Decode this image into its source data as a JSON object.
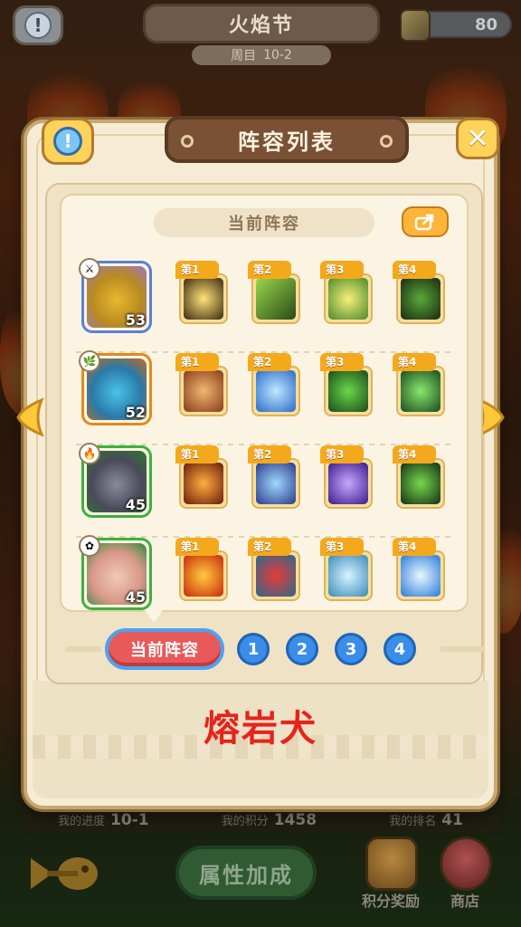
{
  "topbar": {
    "title": "火焰节",
    "subtitle_label": "周目",
    "subtitle_value": "10-2",
    "currency_value": "80"
  },
  "bottombar": {
    "stats": [
      {
        "label": "我的进度",
        "value": "10-1"
      },
      {
        "label": "我的积分",
        "value": "1458"
      },
      {
        "label": "我的排名",
        "value": "41"
      }
    ],
    "attr_button": "属性加成",
    "points_reward": "积分奖励",
    "shop": "商店"
  },
  "modal": {
    "title": "阵容列表",
    "info_glyph": "!",
    "close_glyph": "✕",
    "current_lineup_label": "当前阵容",
    "footer_name": "熔岩犬",
    "rows": [
      {
        "hero_level": "53",
        "hero_frame": "blue",
        "skills": [
          {
            "tag": "第1"
          },
          {
            "tag": "第2"
          },
          {
            "tag": "第3"
          },
          {
            "tag": "第4"
          }
        ]
      },
      {
        "hero_level": "52",
        "hero_frame": "orange",
        "skills": [
          {
            "tag": "第1"
          },
          {
            "tag": "第2"
          },
          {
            "tag": "第3"
          },
          {
            "tag": "第4"
          }
        ]
      },
      {
        "hero_level": "45",
        "hero_frame": "green",
        "skills": [
          {
            "tag": "第1"
          },
          {
            "tag": "第2"
          },
          {
            "tag": "第3"
          },
          {
            "tag": "第4"
          }
        ]
      },
      {
        "hero_level": "45",
        "hero_frame": "green",
        "skills": [
          {
            "tag": "第1"
          },
          {
            "tag": "第2"
          },
          {
            "tag": "第3"
          },
          {
            "tag": "第4"
          }
        ]
      }
    ],
    "tabs": {
      "current": "当前阵容",
      "numbers": [
        "1",
        "2",
        "3",
        "4"
      ]
    }
  },
  "colors": {
    "accent_yellow": "#ffd25a",
    "tag_orange": "#f4a91c",
    "title_brown": "#7a5134",
    "tab_red": "#e85a5a",
    "tab_blue": "#3a8de8",
    "footer_red": "#e5241c"
  }
}
